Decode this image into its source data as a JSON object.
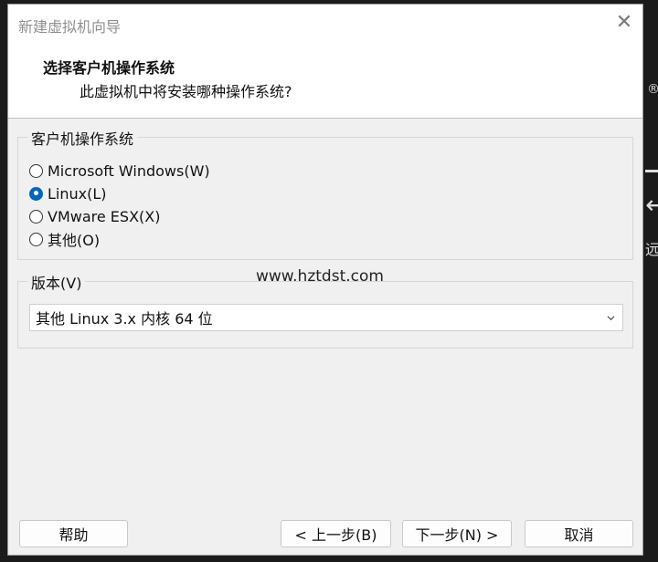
{
  "window": {
    "title": "新建虚拟机向导",
    "close_glyph": "✕"
  },
  "header": {
    "title": "选择客户机操作系统",
    "subtitle": "此虚拟机中将安装哪种操作系统?"
  },
  "os_group": {
    "label": "客户机操作系统",
    "options": [
      {
        "label": "Microsoft Windows(W)",
        "selected": false
      },
      {
        "label": "Linux(L)",
        "selected": true
      },
      {
        "label": "VMware ESX(X)",
        "selected": false
      },
      {
        "label": "其他(O)",
        "selected": false
      }
    ]
  },
  "version_group": {
    "label": "版本(V)",
    "selected_value": "其他 Linux 3.x 内核 64 位"
  },
  "watermark": "www.hztdst.com",
  "buttons": {
    "help": "帮助",
    "back": "< 上一步(B)",
    "next": "下一步(N) >",
    "cancel": "取消"
  },
  "background": {
    "mark": "®",
    "arrow": "←",
    "text": "远"
  },
  "colors": {
    "accent": "#0067c0",
    "dialog_bg": "#f0f0f0"
  }
}
